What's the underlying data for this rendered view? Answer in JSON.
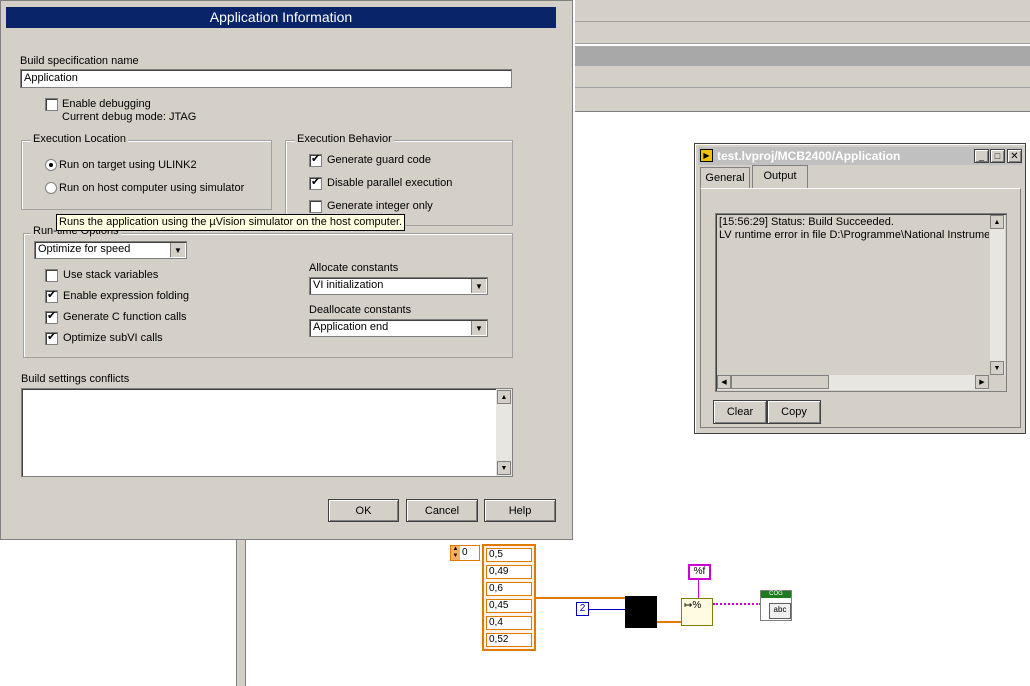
{
  "dialog": {
    "title": "Application Information",
    "build_spec_label": "Build specification name",
    "build_spec_value": "Application",
    "enable_debugging": "Enable debugging",
    "debug_mode": "Current debug mode: JTAG",
    "exec_location": {
      "title": "Execution Location",
      "opt1": "Run on target using ULINK2",
      "opt2": "Run on host computer using simulator"
    },
    "exec_behavior": {
      "title": "Execution Behavior",
      "opt1": "Generate guard code",
      "opt2": "Disable parallel execution",
      "opt3": "Generate integer only"
    },
    "tooltip": "Runs the application using the µVision simulator on the host computer.",
    "runtime": {
      "title": "Run-time Options",
      "optimize_value": "Optimize for speed",
      "use_stack": "Use stack variables",
      "expr_folding": "Enable expression folding",
      "gen_c": "Generate C function calls",
      "opt_subvi": "Optimize subVI calls",
      "alloc_label": "Allocate constants",
      "alloc_value": "VI initialization",
      "dealloc_label": "Deallocate constants",
      "dealloc_value": "Application end"
    },
    "conflicts_label": "Build settings conflicts",
    "ok": "OK",
    "cancel": "Cancel",
    "help": "Help"
  },
  "output_window": {
    "title": "test.lvproj/MCB2400/Application",
    "tab_general": "General",
    "tab_output": "Output",
    "line1": "[15:56:29] Status: Build Succeeded.",
    "line2": "LV runtime error in file D:\\Programme\\National Instrumen",
    "clear": "Clear",
    "copy": "Copy"
  },
  "diagram": {
    "index": "0",
    "array_values": [
      "0,5",
      "0,49",
      "0,6",
      "0,45",
      "0,4",
      "0,52"
    ],
    "const_2": "2",
    "format": "%f",
    "cog_label": "COG",
    "abc_label": "abc"
  }
}
